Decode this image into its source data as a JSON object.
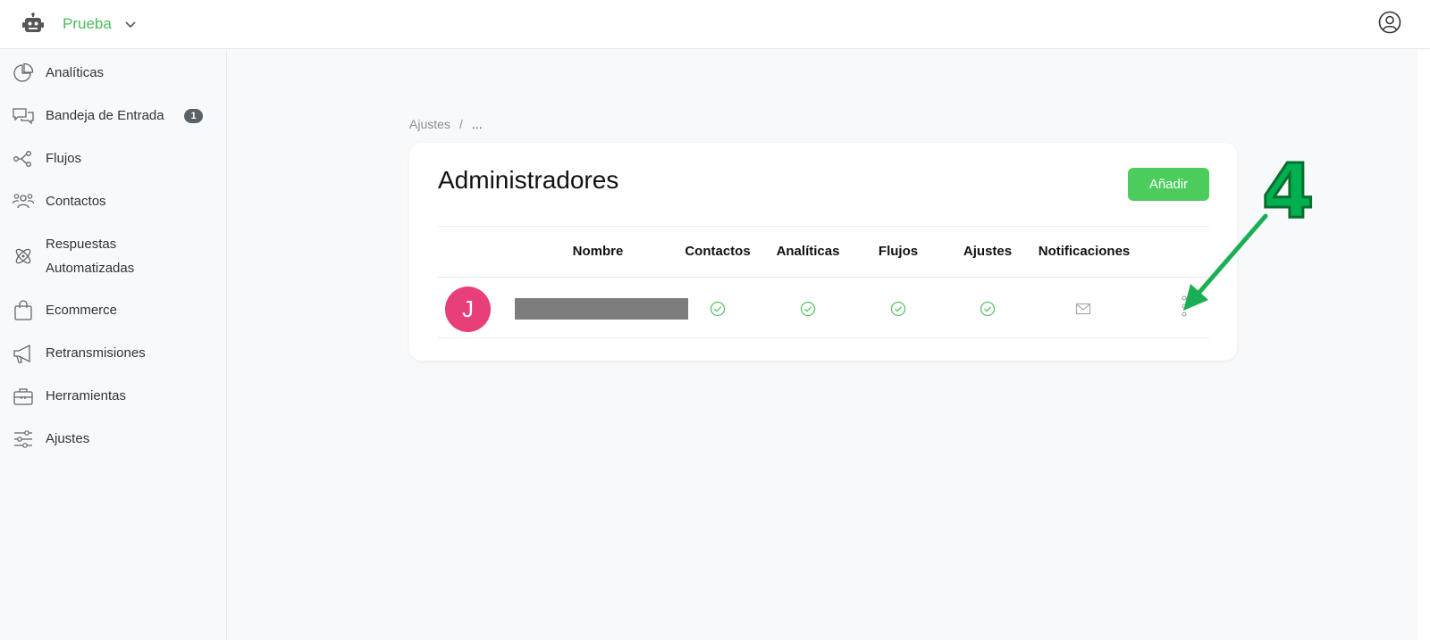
{
  "header": {
    "bot_name": "Prueba",
    "icons": {
      "logo": "robot-icon",
      "dropdown": "chevron-down-icon",
      "user": "user-circle-icon"
    }
  },
  "sidebar": {
    "items": [
      {
        "label": "Analíticas",
        "icon": "pie-chart-icon"
      },
      {
        "label": "Bandeja de Entrada",
        "icon": "chat-bubbles-icon",
        "badge": "1"
      },
      {
        "label": "Flujos",
        "icon": "flow-icon"
      },
      {
        "label": "Contactos",
        "icon": "users-icon"
      },
      {
        "label": "Respuestas Automatizadas",
        "label_line1": "Respuestas",
        "label_line2": "Automatizadas",
        "icon": "atom-icon"
      },
      {
        "label": "Ecommerce",
        "icon": "shopping-bag-icon"
      },
      {
        "label": "Retransmisiones",
        "icon": "megaphone-icon"
      },
      {
        "label": "Herramientas",
        "icon": "toolbox-icon"
      },
      {
        "label": "Ajustes",
        "icon": "sliders-icon"
      }
    ]
  },
  "breadcrumb": {
    "root": "Ajustes",
    "separator": "/",
    "current": "..."
  },
  "card": {
    "title": "Administradores",
    "add_button": "Añadir",
    "columns": [
      "Nombre",
      "Contactos",
      "Analíticas",
      "Flujos",
      "Ajustes",
      "Notificaciones"
    ],
    "rows": [
      {
        "avatar_initial": "J",
        "avatar_color": "#e83e7a",
        "name_redacted": true,
        "permissions": {
          "contactos": true,
          "analiticas": true,
          "flujos": true,
          "ajustes": true
        },
        "notifications_icon": "envelope-icon",
        "menu_icon": "vertical-dots-icon"
      }
    ]
  },
  "annotation": {
    "number": "4",
    "color": "#00b050"
  },
  "colors": {
    "brand_green": "#4cbb5c",
    "button_green": "#4ccc5c",
    "check_green": "#5cc46b",
    "badge": "#5a6268"
  }
}
